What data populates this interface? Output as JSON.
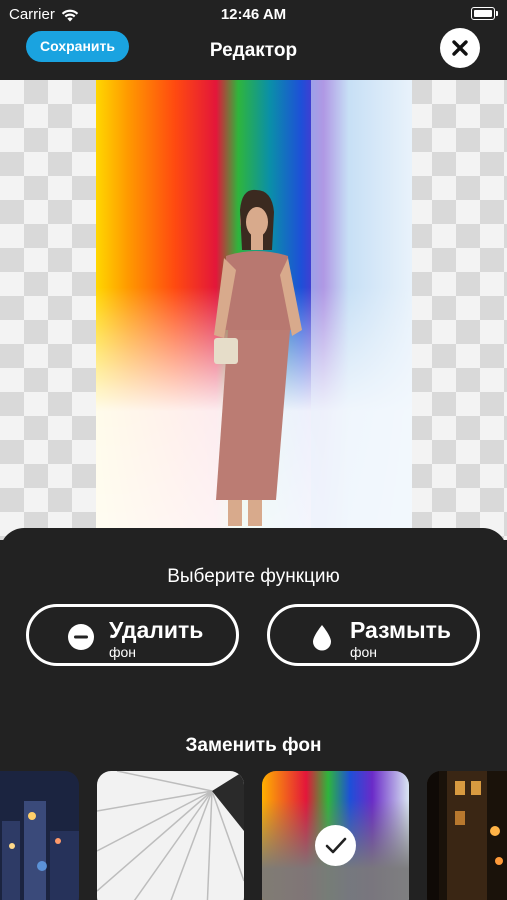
{
  "status_bar": {
    "carrier": "Carrier",
    "time": "12:46 AM"
  },
  "nav": {
    "save_label": "Сохранить",
    "title": "Редактор"
  },
  "sheet": {
    "choose_title": "Выберите функцию",
    "remove": {
      "title": "Удалить",
      "subtitle": "фон",
      "icon": "minus-circle-icon"
    },
    "blur": {
      "title": "Размыть",
      "subtitle": "фон",
      "icon": "drop-icon"
    },
    "replace_title": "Заменить фон"
  },
  "backgrounds": [
    {
      "name": "city-night",
      "selected": false
    },
    {
      "name": "white-rays",
      "selected": false
    },
    {
      "name": "rainbow-paint",
      "selected": true
    },
    {
      "name": "street-night",
      "selected": false
    }
  ],
  "colors": {
    "accent": "#1aa3e0",
    "sheet": "#222222"
  }
}
